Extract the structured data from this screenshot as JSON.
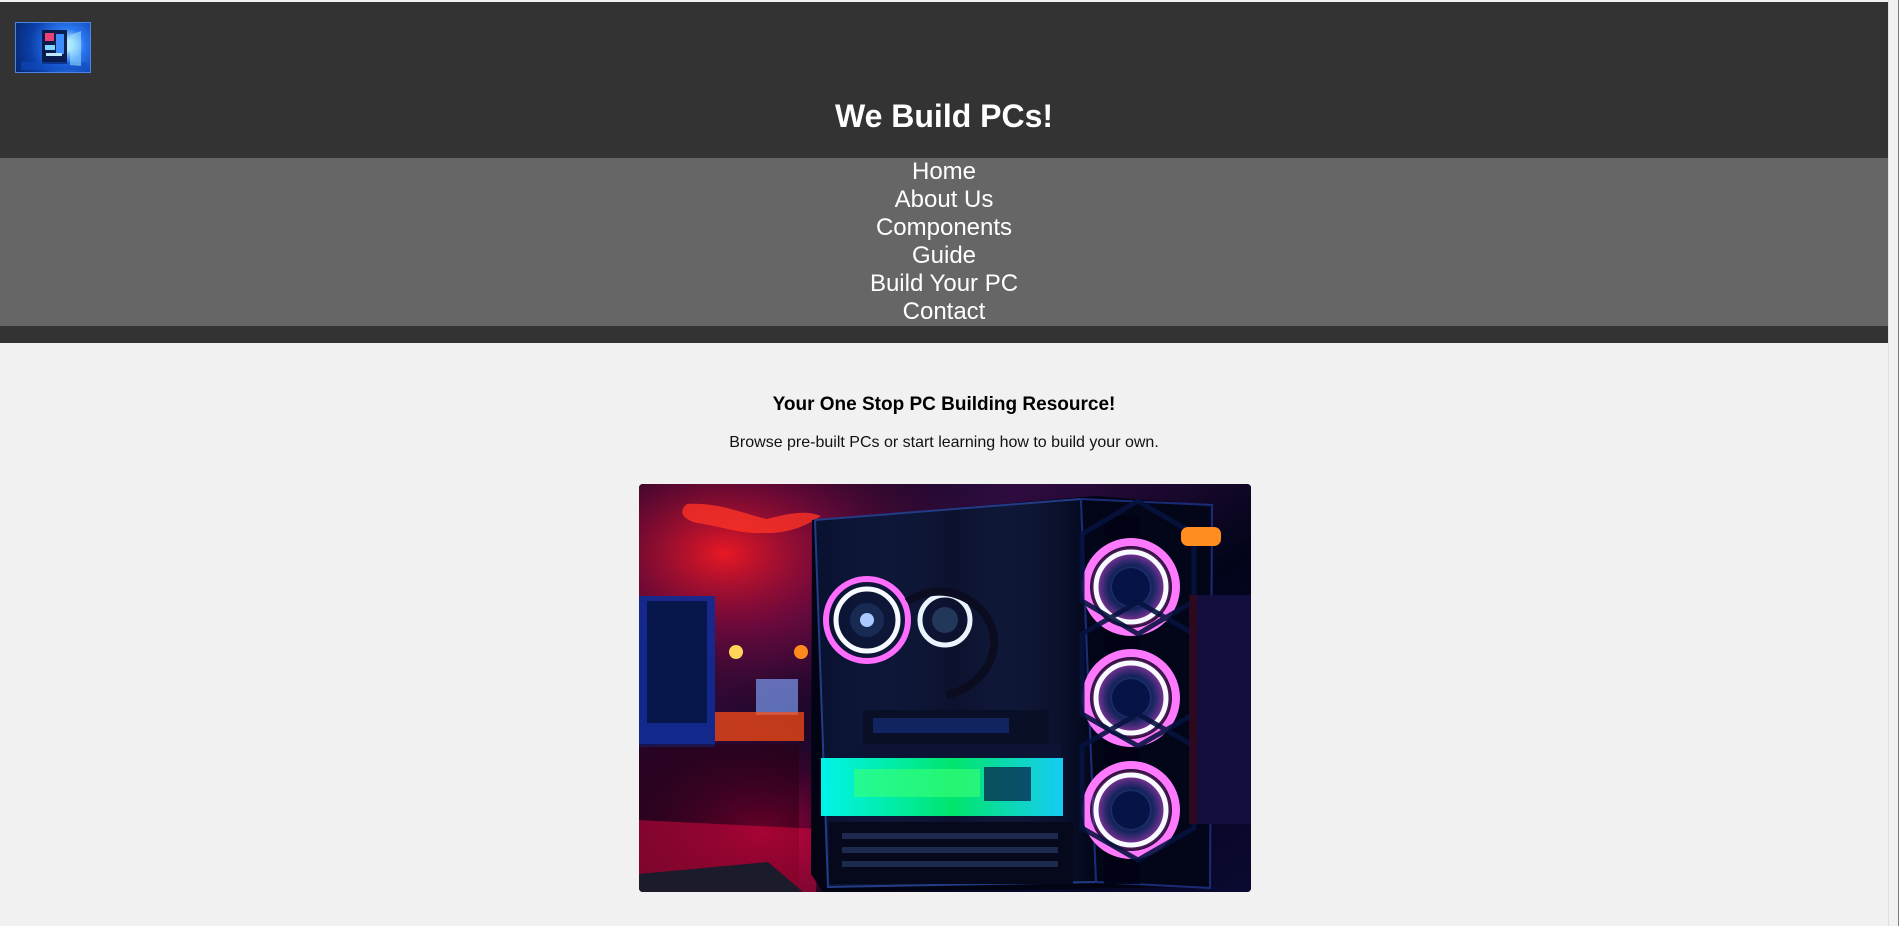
{
  "site": {
    "title": "We Build PCs!"
  },
  "nav": {
    "items": [
      {
        "label": "Home"
      },
      {
        "label": "About Us"
      },
      {
        "label": "Components"
      },
      {
        "label": "Guide"
      },
      {
        "label": "Build Your PC"
      },
      {
        "label": "Contact"
      }
    ]
  },
  "hero": {
    "heading": "Your One Stop PC Building Resource!",
    "subtitle": "Browse pre-built PCs or start learning how to build your own."
  },
  "colors": {
    "header_background": "#333333",
    "nav_background": "#666666",
    "page_background": "#f1f1f2",
    "text_light": "#ffffff"
  },
  "icons": {
    "logo": "pc-build-logo",
    "hero_image": "rgb-gaming-pc-image"
  }
}
